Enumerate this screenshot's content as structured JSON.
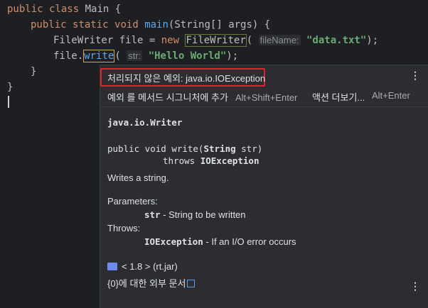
{
  "editor": {
    "line1": {
      "kw1": "public",
      "kw2": "class",
      "name": "Main",
      "brace": " {"
    },
    "line2": {
      "kw1": "public",
      "kw2": "static",
      "kw3": "void",
      "fn": "main",
      "params": "(String[] args) {"
    },
    "line3": {
      "type": "FileWriter",
      "var": " file = ",
      "kw": "new",
      "ctor": "FileWriter",
      "open": "(",
      "hint": "fileName:",
      "str": "\"data.txt\"",
      "close": ");"
    },
    "line4": {
      "obj": "file.",
      "method": "write",
      "open": "(",
      "hint": "str:",
      "str": "\"Hello World\"",
      "close": ");"
    },
    "line5": "}",
    "line6": "}"
  },
  "popup": {
    "problem": "처리되지 않은 예외: java.io.IOException",
    "action_label": "예외 를 메서드 시그니처에 추가",
    "action_shortcut": "Alt+Shift+Enter",
    "more_label": "액션 더보기...",
    "more_shortcut": "Alt+Enter",
    "doc": {
      "class_name": "java.io.Writer",
      "signature_prefix": "public void write(",
      "signature_param_type": "String",
      "signature_param_name": " str)",
      "throws_kw": "throws ",
      "throws_type": "IOException",
      "description": "Writes a string.",
      "parameters_label": "Parameters:",
      "param_name": "str",
      "param_desc": " - String to be written",
      "throws_label": "Throws:",
      "throws_name": "IOException",
      "throws_desc": " - If an I/O error occurs",
      "library": "< 1.8 > (rt.jar)",
      "external_docs": "{0}에 대한 외부 문서"
    }
  },
  "icons": {
    "kebab": "more-vertical-icon",
    "library": "library-icon",
    "external": "external-link-icon"
  }
}
